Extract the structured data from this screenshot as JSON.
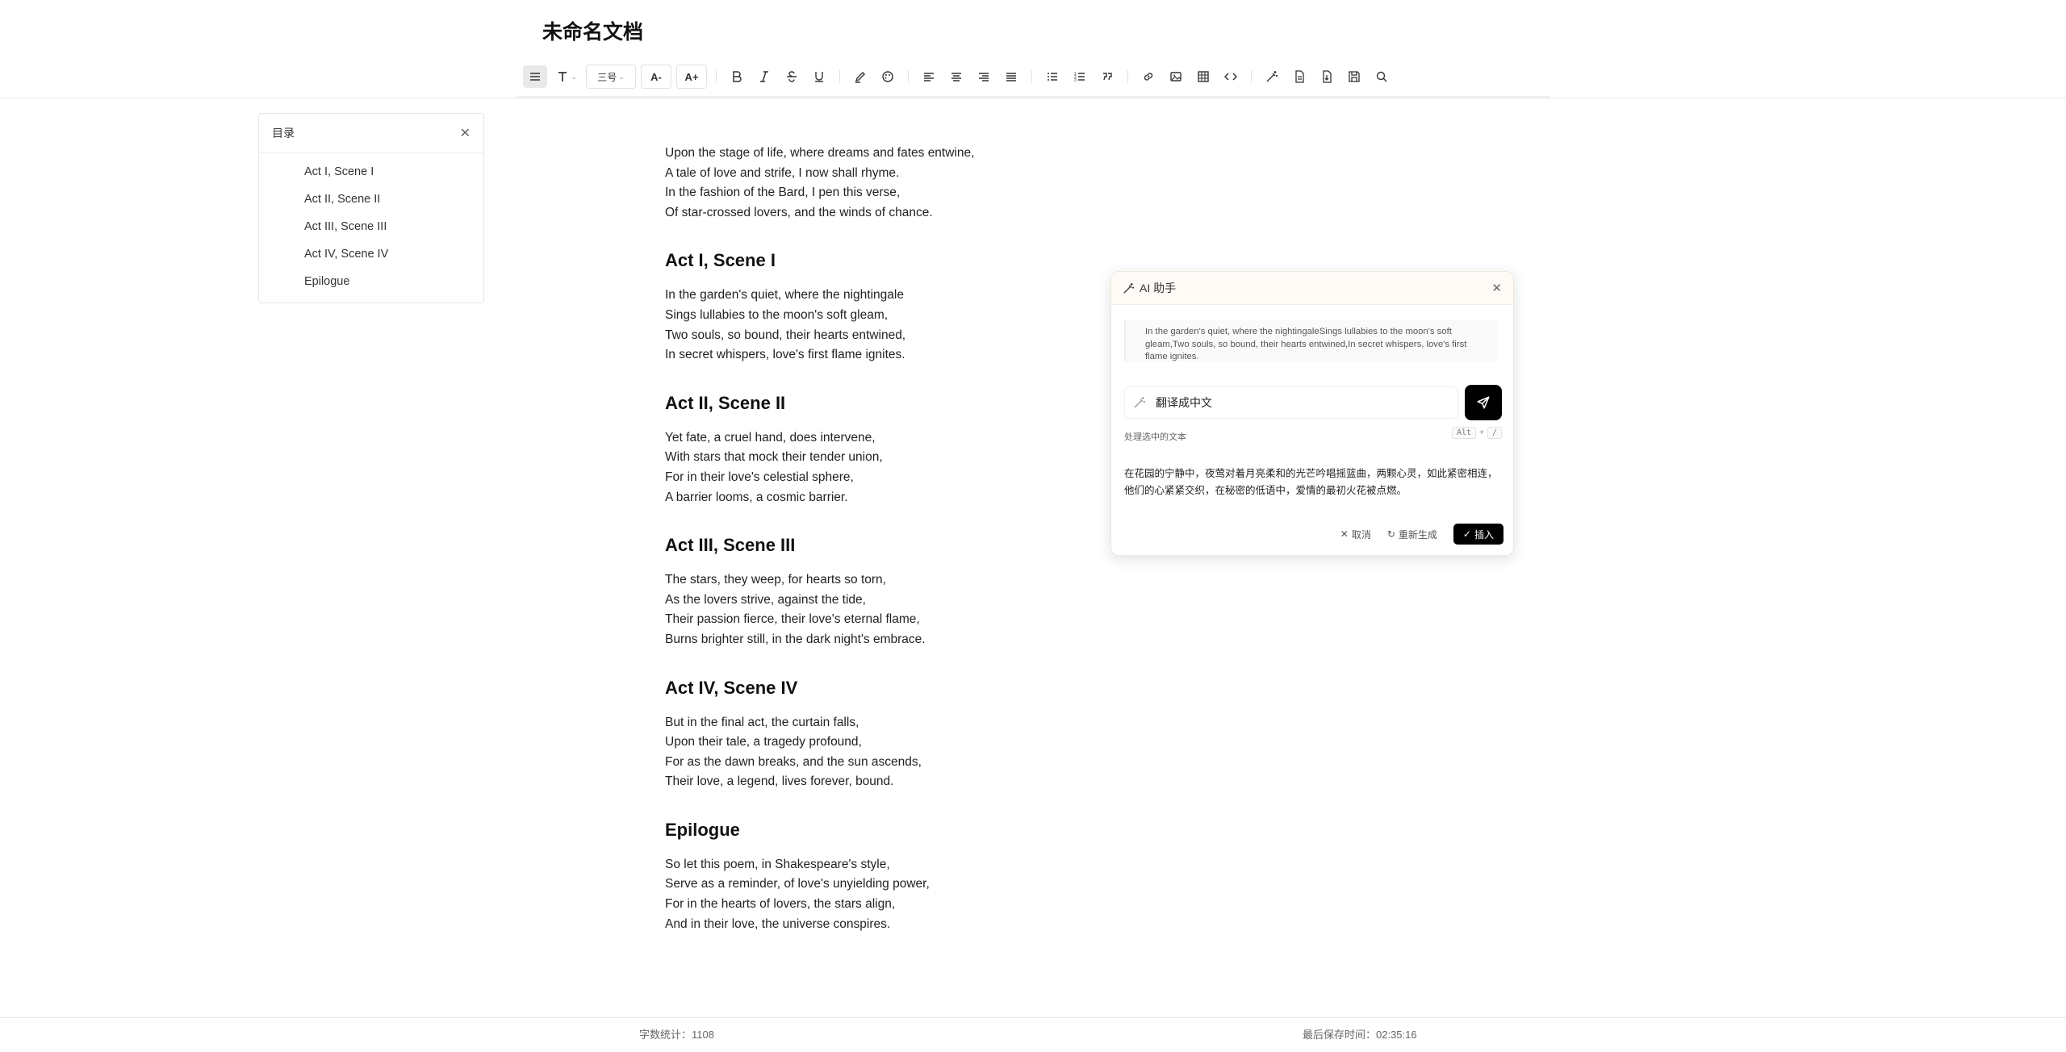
{
  "document": {
    "title": "未命名文档"
  },
  "toolbar": {
    "heading_style": "三号",
    "font_decrease": "A-",
    "font_increase": "A+"
  },
  "toc": {
    "title": "目录",
    "items": [
      "Act I, Scene I",
      "Act II, Scene II",
      "Act III, Scene III",
      "Act IV, Scene IV",
      "Epilogue"
    ]
  },
  "content": {
    "intro": [
      "Upon the stage of life, where dreams and fates entwine,",
      "A tale of love and strife, I now shall rhyme.",
      "In the fashion of the Bard, I pen this verse,",
      "Of star-crossed lovers, and the winds of chance."
    ],
    "sections": [
      {
        "heading": "Act I, Scene I",
        "lines": [
          "In the garden's quiet, where the nightingale",
          "Sings lullabies to the moon's soft gleam,",
          "Two souls, so bound, their hearts entwined,",
          "In secret whispers, love's first flame ignites."
        ]
      },
      {
        "heading": "Act II, Scene II",
        "lines": [
          "Yet fate, a cruel hand, does intervene,",
          "With stars that mock their tender union,",
          "For in their love's celestial sphere,",
          "A barrier looms, a cosmic barrier."
        ]
      },
      {
        "heading": "Act III, Scene III",
        "lines": [
          "The stars, they weep, for hearts so torn,",
          "As the lovers strive, against the tide,",
          "Their passion fierce, their love's eternal flame,",
          "Burns brighter still, in the dark night's embrace."
        ]
      },
      {
        "heading": "Act IV, Scene IV",
        "lines": [
          "But in the final act, the curtain falls,",
          "Upon their tale, a tragedy profound,",
          "For as the dawn breaks, and the sun ascends,",
          "Their love, a legend, lives forever, bound."
        ]
      },
      {
        "heading": "Epilogue",
        "lines": [
          "So let this poem, in Shakespeare's style,",
          "Serve as a reminder, of love's unyielding power,",
          "For in the hearts of lovers, the stars align,",
          "And in their love, the universe conspires."
        ]
      }
    ]
  },
  "ai_panel": {
    "title": "AI 助手",
    "selected_text": "In the garden's quiet, where the nightingaleSings lullabies to the moon's soft gleam,Two souls, so bound, their hearts entwined,In secret whispers, love's first flame ignites.",
    "prompt_value": "翻译成中文",
    "hint": "处理选中的文本",
    "shortcut": [
      "Alt",
      "+",
      "/"
    ],
    "result": "在花园的宁静中，夜莺对着月亮柔和的光芒吟唱摇篮曲，两颗心灵，如此紧密相连，他们的心紧紧交织，在秘密的低语中，爱情的最初火花被点燃。",
    "cancel_label": "取消",
    "regenerate_label": "重新生成",
    "insert_label": "插入"
  },
  "footer": {
    "word_count": "字数统计：1108",
    "last_saved": "最后保存时间：02:35:16"
  }
}
